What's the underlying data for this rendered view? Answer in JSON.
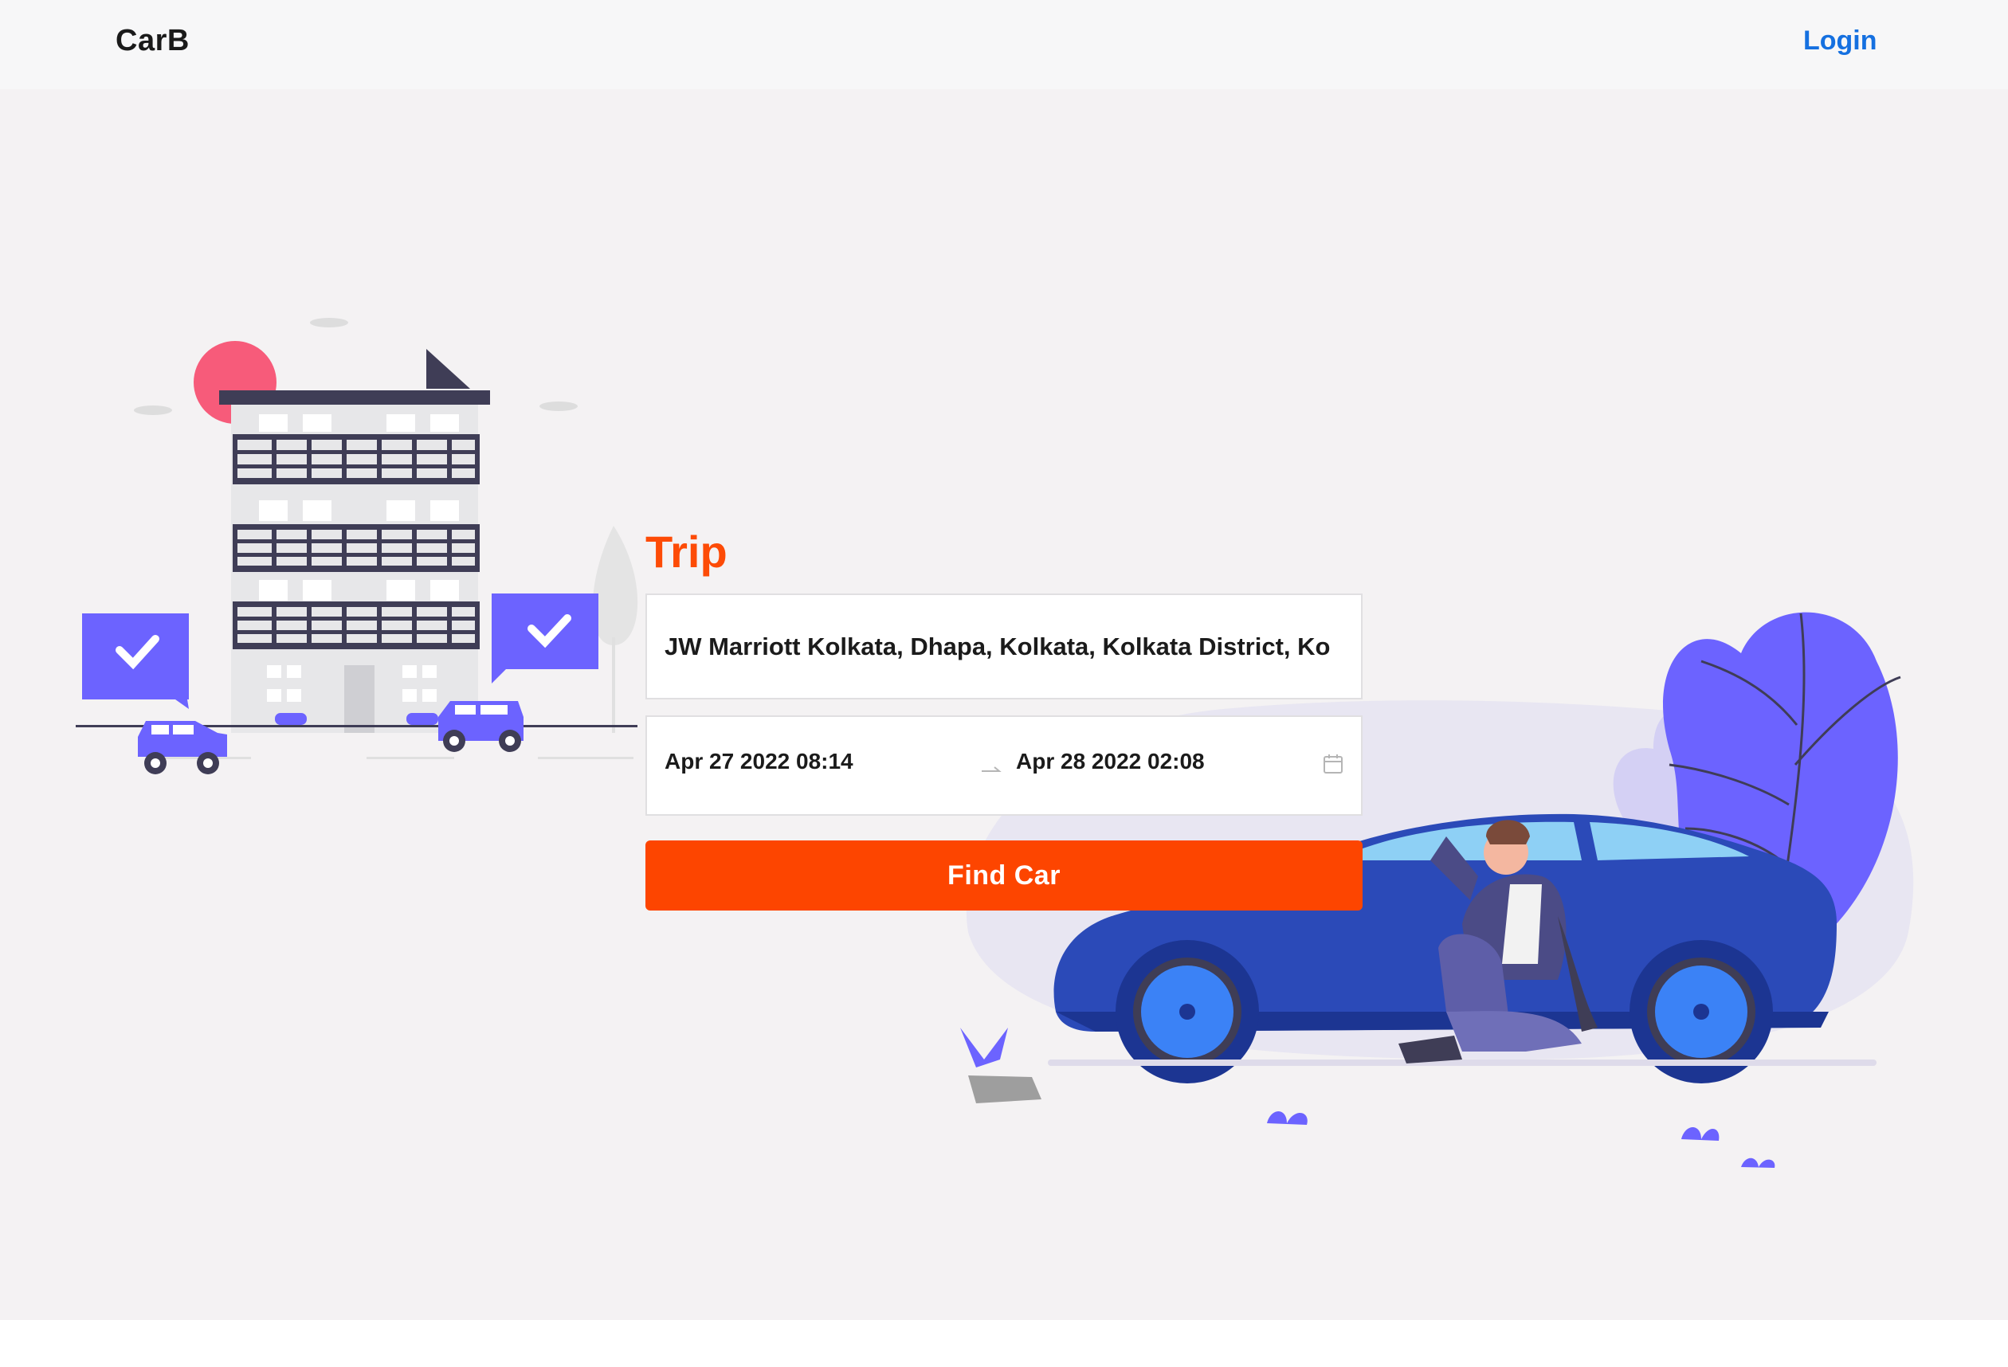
{
  "navbar": {
    "brand": "CarB",
    "login_label": "Login"
  },
  "trip": {
    "title": "Trip",
    "location_value": "JW Marriott Kolkata, Dhapa, Kolkata, Kolkata District, Ko",
    "start_datetime": "Apr 27 2022 08:14",
    "end_datetime": "Apr 28 2022 02:08",
    "find_button_label": "Find Car"
  },
  "colors": {
    "accent": "#fd4500",
    "link": "#1570e0",
    "illustration_primary": "#6c63ff",
    "car_blue": "#2b4ab8"
  },
  "icons": {
    "date_separator": "arrow-right-icon",
    "date_picker": "calendar-icon"
  }
}
